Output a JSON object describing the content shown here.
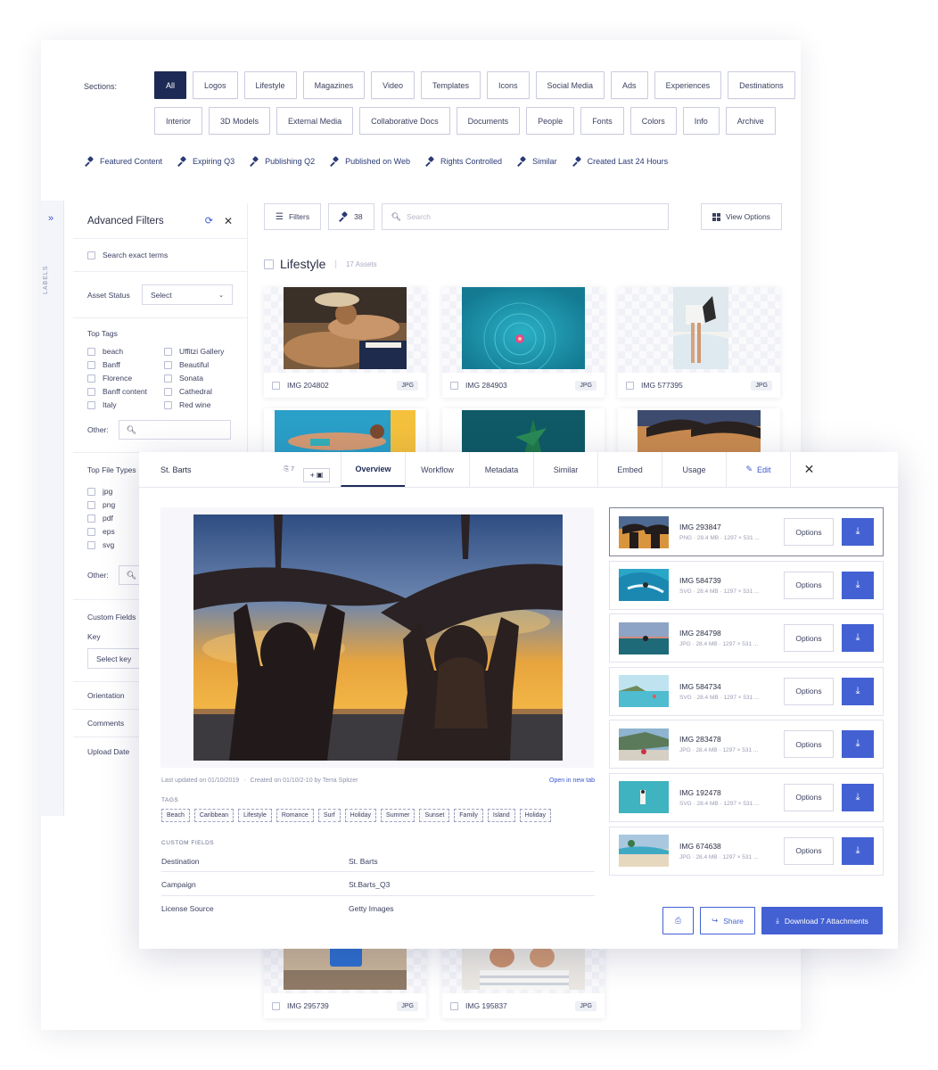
{
  "sections": {
    "label": "Sections:",
    "chips": [
      "All",
      "Logos",
      "Lifestyle",
      "Magazines",
      "Video",
      "Templates",
      "Icons",
      "Social Media",
      "Ads",
      "Experiences",
      "Destinations",
      "Interior",
      "3D Models",
      "External Media",
      "Collaborative Docs",
      "Documents",
      "People",
      "Fonts",
      "Colors",
      "Info",
      "Archive"
    ],
    "active": "All"
  },
  "saved_searches": [
    "Featured Content",
    "Expiring Q3",
    "Publishing Q2",
    "Published on Web",
    "Rights Controlled",
    "Similar",
    "Created Last 24 Hours"
  ],
  "rail": {
    "label": "LABELS"
  },
  "filters": {
    "title": "Advanced Filters",
    "search_exact": "Search exact terms",
    "asset_status_label": "Asset Status",
    "asset_status_value": "Select",
    "top_tags_label": "Top Tags",
    "top_tags": [
      "beach",
      "Uffitzi Gallery",
      "Banff",
      "Beautiful",
      "Florence",
      "Sonata",
      "Banff content",
      "Cathedral",
      "Italy",
      "Red wine"
    ],
    "other_label": "Other:",
    "file_types_label": "Top File Types",
    "file_types": [
      "jpg",
      "png",
      "pdf",
      "eps",
      "svg"
    ],
    "custom_fields_label": "Custom Fields",
    "key_label": "Key",
    "key_placeholder": "Select key",
    "orientation": "Orientation",
    "comments": "Comments",
    "upload_date": "Upload Date"
  },
  "toolbar": {
    "filters": "Filters",
    "pinned_count": "38",
    "search_placeholder": "Search",
    "view_options": "View Options"
  },
  "collection": {
    "title": "Lifestyle",
    "count": "17 Assets"
  },
  "assets": [
    {
      "name": "IMG 204802",
      "type": "JPG"
    },
    {
      "name": "IMG 284903",
      "type": "JPG"
    },
    {
      "name": "IMG 577395",
      "type": "JPG"
    },
    {
      "name": "IMG 295739",
      "type": "JPG"
    },
    {
      "name": "IMG 195837",
      "type": "JPG"
    }
  ],
  "modal": {
    "title": "St. Barts",
    "count": "7",
    "add_label": "+",
    "tabs": [
      "Overview",
      "Workflow",
      "Metadata",
      "Similar",
      "Embed",
      "Usage"
    ],
    "active_tab": "Overview",
    "edit": "Edit",
    "last_updated": "Last updated on 01/10/2019",
    "created": "Created on 01/10/2-10 by Terra Spitzer",
    "open_new_tab": "Open in new tab",
    "tags_label": "TAGS",
    "tags": [
      "Beach",
      "Caribbean",
      "Lifestyle",
      "Romance",
      "Surf",
      "Holiday",
      "Summer",
      "Sunset",
      "Family",
      "Island",
      "Holiday"
    ],
    "custom_fields_label": "CUSTOM FIELDS",
    "custom_fields": [
      {
        "key": "Destination",
        "value": "St. Barts"
      },
      {
        "key": "Campaign",
        "value": "St.Barts_Q3"
      },
      {
        "key": "License Source",
        "value": "Getty Images"
      }
    ],
    "attachments": [
      {
        "name": "IMG 293847",
        "type": "PNG",
        "size": "28.4 MB",
        "dims": "1297 × 531 ..."
      },
      {
        "name": "IMG 584739",
        "type": "SVG",
        "size": "28.4 MB",
        "dims": "1297 × 531 ..."
      },
      {
        "name": "IMG 284798",
        "type": "JPG",
        "size": "28.4 MB",
        "dims": "1297 × 531 ..."
      },
      {
        "name": "IMG 584734",
        "type": "SVG",
        "size": "28.4 MB",
        "dims": "1297 × 531 ..."
      },
      {
        "name": "IMG 283478",
        "type": "JPG",
        "size": "28.4 MB",
        "dims": "1297 × 531 ..."
      },
      {
        "name": "IMG 192478",
        "type": "SVG",
        "size": "28.4 MB",
        "dims": "1297 × 531 ..."
      },
      {
        "name": "IMG 674638",
        "type": "JPG",
        "size": "28.4 MB",
        "dims": "1297 × 531 ..."
      }
    ],
    "options_label": "Options",
    "share": "Share",
    "download_all": "Download 7 Attachments"
  },
  "colors": {
    "navy": "#1c2a55",
    "accent": "#4361d3"
  }
}
